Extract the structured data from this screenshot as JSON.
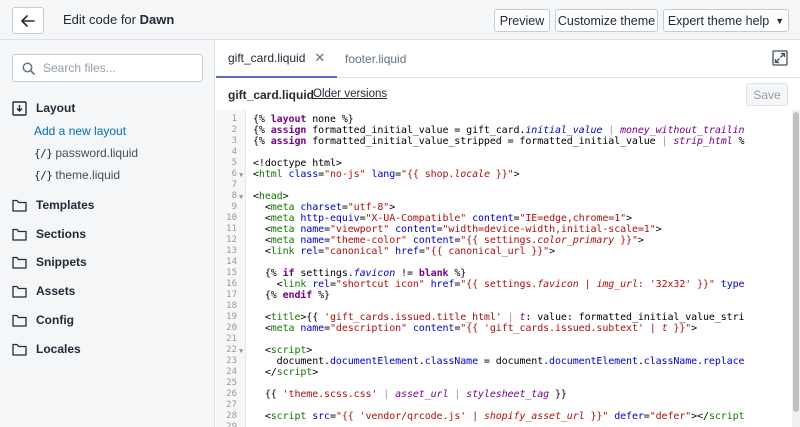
{
  "header": {
    "title_prefix": "Edit code for",
    "theme_name": "Dawn",
    "preview_label": "Preview",
    "customize_label": "Customize theme",
    "expert_help_label": "Expert theme help"
  },
  "sidebar": {
    "search_placeholder": "Search files...",
    "folders": {
      "layout": "Layout",
      "templates": "Templates",
      "sections": "Sections",
      "snippets": "Snippets",
      "assets": "Assets",
      "config": "Config",
      "locales": "Locales"
    },
    "add_layout_label": "Add a new layout",
    "files": [
      "password.liquid",
      "theme.liquid"
    ],
    "file_icon": "{/}"
  },
  "tabs": [
    {
      "label": "gift_card.liquid",
      "active": true
    },
    {
      "label": "footer.liquid",
      "active": false
    }
  ],
  "editor": {
    "filename": "gift_card.liquid",
    "older_versions_label": "Older versions",
    "save_label": "Save",
    "line_numbers": [
      "1",
      "2",
      "3",
      "4",
      "5",
      "6",
      "7",
      "8",
      "9",
      "10",
      "11",
      "12",
      "13",
      "14",
      "15",
      "16",
      "17",
      "18",
      "19",
      "20",
      "21",
      "22",
      "23",
      "24",
      "25",
      "26",
      "27",
      "28",
      "29"
    ]
  },
  "colors": {
    "accent": "#5c6ac4",
    "link": "#006fbb",
    "sidebar_bg": "#f4f6f8"
  }
}
